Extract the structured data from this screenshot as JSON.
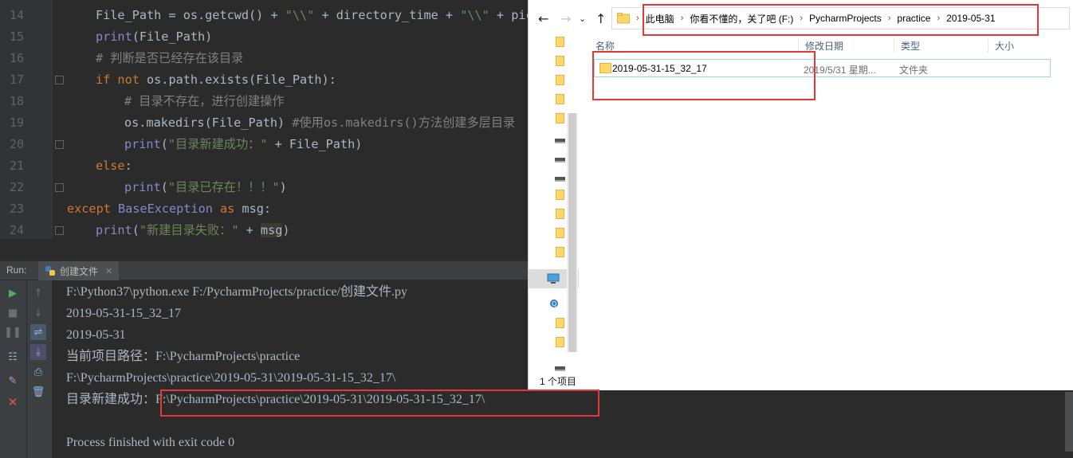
{
  "editor": {
    "line_numbers": [
      "14",
      "15",
      "16",
      "17",
      "18",
      "19",
      "20",
      "21",
      "22",
      "23",
      "24"
    ],
    "lines": [
      {
        "segments": [
          {
            "t": "File_Path = os.getcwd() + ",
            "c": ""
          },
          {
            "t": "\"\\\\\"",
            "c": "str"
          },
          {
            "t": " + directory_time + ",
            "c": ""
          },
          {
            "t": "\"\\\\\"",
            "c": "str"
          },
          {
            "t": " + pic",
            "c": ""
          }
        ]
      },
      {
        "segments": [
          {
            "t": "print",
            "c": "bi"
          },
          {
            "t": "(File_Path)",
            "c": ""
          }
        ]
      },
      {
        "segments": [
          {
            "t": "# 判断是否已经存在该目录",
            "c": "cm"
          }
        ]
      },
      {
        "segments": [
          {
            "t": "if not ",
            "c": "kw"
          },
          {
            "t": "os.path.exists(File_Path):",
            "c": ""
          }
        ]
      },
      {
        "segments": [
          {
            "t": "# 目录不存在，进行创建操作",
            "c": "cm"
          }
        ]
      },
      {
        "segments": [
          {
            "t": "os.makedirs(File_Path) ",
            "c": ""
          },
          {
            "t": "#使用os.makedirs()方法创建多层目录",
            "c": "cm"
          }
        ]
      },
      {
        "segments": [
          {
            "t": "print",
            "c": "bi"
          },
          {
            "t": "(",
            "c": ""
          },
          {
            "t": "\"目录新建成功：\"",
            "c": "str"
          },
          {
            "t": " + File_Path)",
            "c": ""
          }
        ]
      },
      {
        "segments": [
          {
            "t": "else",
            "c": "kw"
          },
          {
            "t": ":",
            "c": ""
          }
        ]
      },
      {
        "segments": [
          {
            "t": "print",
            "c": "bi"
          },
          {
            "t": "(",
            "c": ""
          },
          {
            "t": "\"目录已存在！！！\"",
            "c": "str"
          },
          {
            "t": ")",
            "c": ""
          }
        ]
      },
      {
        "segments": [
          {
            "t": "except ",
            "c": "kw"
          },
          {
            "t": "BaseException ",
            "c": "bi"
          },
          {
            "t": "as ",
            "c": "kw"
          },
          {
            "t": "msg:",
            "c": ""
          }
        ]
      },
      {
        "segments": [
          {
            "t": "print",
            "c": "bi"
          },
          {
            "t": "(",
            "c": ""
          },
          {
            "t": "\"新建目录失败：\"",
            "c": "str"
          },
          {
            "t": " + ",
            "c": ""
          },
          {
            "t": "msg",
            "c": "hl"
          },
          {
            "t": ")",
            "c": ""
          }
        ]
      }
    ]
  },
  "run_panel": {
    "title": "Run:",
    "tab_label": "创建文件",
    "console_lines": [
      "F:\\Python37\\python.exe F:/PycharmProjects/practice/创建文件.py",
      "2019-05-31-15_32_17",
      "2019-05-31",
      "当前项目路径：F:\\PycharmProjects\\practice",
      "F:\\PycharmProjects\\practice\\2019-05-31\\2019-05-31-15_32_17\\",
      "目录新建成功：F:\\PycharmProjects\\practice\\2019-05-31\\2019-05-31-15_32_17\\",
      "",
      "Process finished with exit code 0"
    ]
  },
  "explorer": {
    "breadcrumb": [
      "此电脑",
      "你看不懂的，关了吧 (F:)",
      "PycharmProjects",
      "practice",
      "2019-05-31"
    ],
    "columns": {
      "name": "名称",
      "modified": "修改日期",
      "type": "类型",
      "size": "大小"
    },
    "files": [
      {
        "name": "2019-05-31-15_32_17",
        "modified": "2019/5/31 星期...",
        "type": "文件夹",
        "size": ""
      }
    ],
    "status": "1 个项目"
  },
  "colors": {
    "editor_bg": "#2b2b2b",
    "highlight_box": "#e53935",
    "keyword": "#cc7832",
    "string": "#6a8759",
    "comment": "#808080"
  }
}
